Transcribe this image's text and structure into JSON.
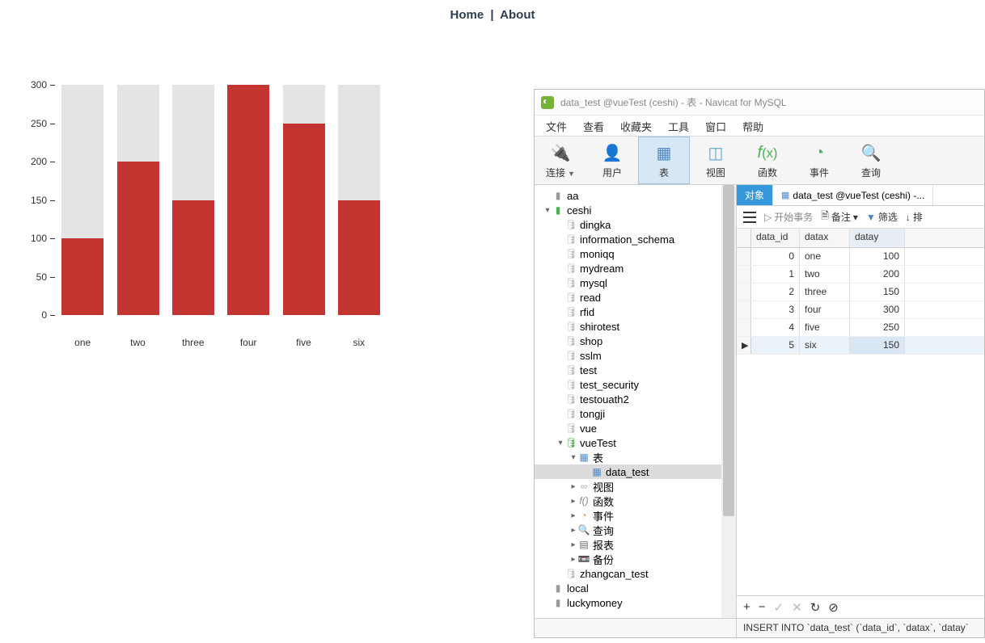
{
  "nav": {
    "home": "Home",
    "about": "About",
    "sep": "|"
  },
  "chart_data": {
    "type": "bar",
    "categories": [
      "one",
      "two",
      "three",
      "four",
      "five",
      "six"
    ],
    "values": [
      100,
      200,
      150,
      300,
      250,
      150
    ],
    "y_ticks": [
      0,
      50,
      100,
      150,
      200,
      250,
      300
    ],
    "ylim": [
      0,
      300
    ],
    "bar_color": "#c23531",
    "bg_color": "#e4e4e4"
  },
  "navicat": {
    "title": "data_test @vueTest (ceshi) - 表 - Navicat for MySQL",
    "menu": [
      "文件",
      "查看",
      "收藏夹",
      "工具",
      "窗口",
      "帮助"
    ],
    "toolbar": [
      {
        "label": "连接",
        "icon": "plug",
        "dd": true
      },
      {
        "label": "用户",
        "icon": "user"
      },
      {
        "label": "表",
        "icon": "table",
        "active": true
      },
      {
        "label": "视图",
        "icon": "view"
      },
      {
        "label": "函数",
        "icon": "fx"
      },
      {
        "label": "事件",
        "icon": "event"
      },
      {
        "label": "查询",
        "icon": "query"
      }
    ],
    "tree": {
      "conn_aa": "aa",
      "conn_ceshi": "ceshi",
      "dbs_ceshi": [
        "dingka",
        "information_schema",
        "moniqq",
        "mydream",
        "mysql",
        "read",
        "rfid",
        "shirotest",
        "shop",
        "sslm",
        "test",
        "test_security",
        "testouath2",
        "tongji",
        "vue"
      ],
      "db_vueTest": "vueTest",
      "folders": {
        "table": "表",
        "view": "视图",
        "fx": "函数",
        "event": "事件",
        "query": "查询",
        "report": "报表",
        "backup": "备份"
      },
      "selected_table": "data_test",
      "db_zhangcan": "zhangcan_test",
      "conn_local": "local",
      "conn_luckymoney": "luckymoney"
    },
    "tabs": {
      "objects": "对象",
      "data_test": "data_test @vueTest (ceshi) -..."
    },
    "subbar": {
      "begin_tx": "开始事务",
      "memo": "备注",
      "filter": "筛选",
      "sort": "排"
    },
    "grid": {
      "headers": [
        "data_id",
        "datax",
        "datay"
      ],
      "rows": [
        {
          "data_id": 0,
          "datax": "one",
          "datay": 100
        },
        {
          "data_id": 1,
          "datax": "two",
          "datay": 200
        },
        {
          "data_id": 2,
          "datax": "three",
          "datay": 150
        },
        {
          "data_id": 3,
          "datax": "four",
          "datay": 300
        },
        {
          "data_id": 4,
          "datax": "five",
          "datay": 250
        },
        {
          "data_id": 5,
          "datax": "six",
          "datay": 150
        }
      ],
      "selected_row_index": 5
    },
    "bottom": {
      "plus": "+",
      "minus": "−",
      "check": "✓",
      "x": "✕",
      "refresh": "↻",
      "stop": "⊘"
    },
    "status_sql": "INSERT INTO `data_test` (`data_id`, `datax`, `datay`"
  }
}
